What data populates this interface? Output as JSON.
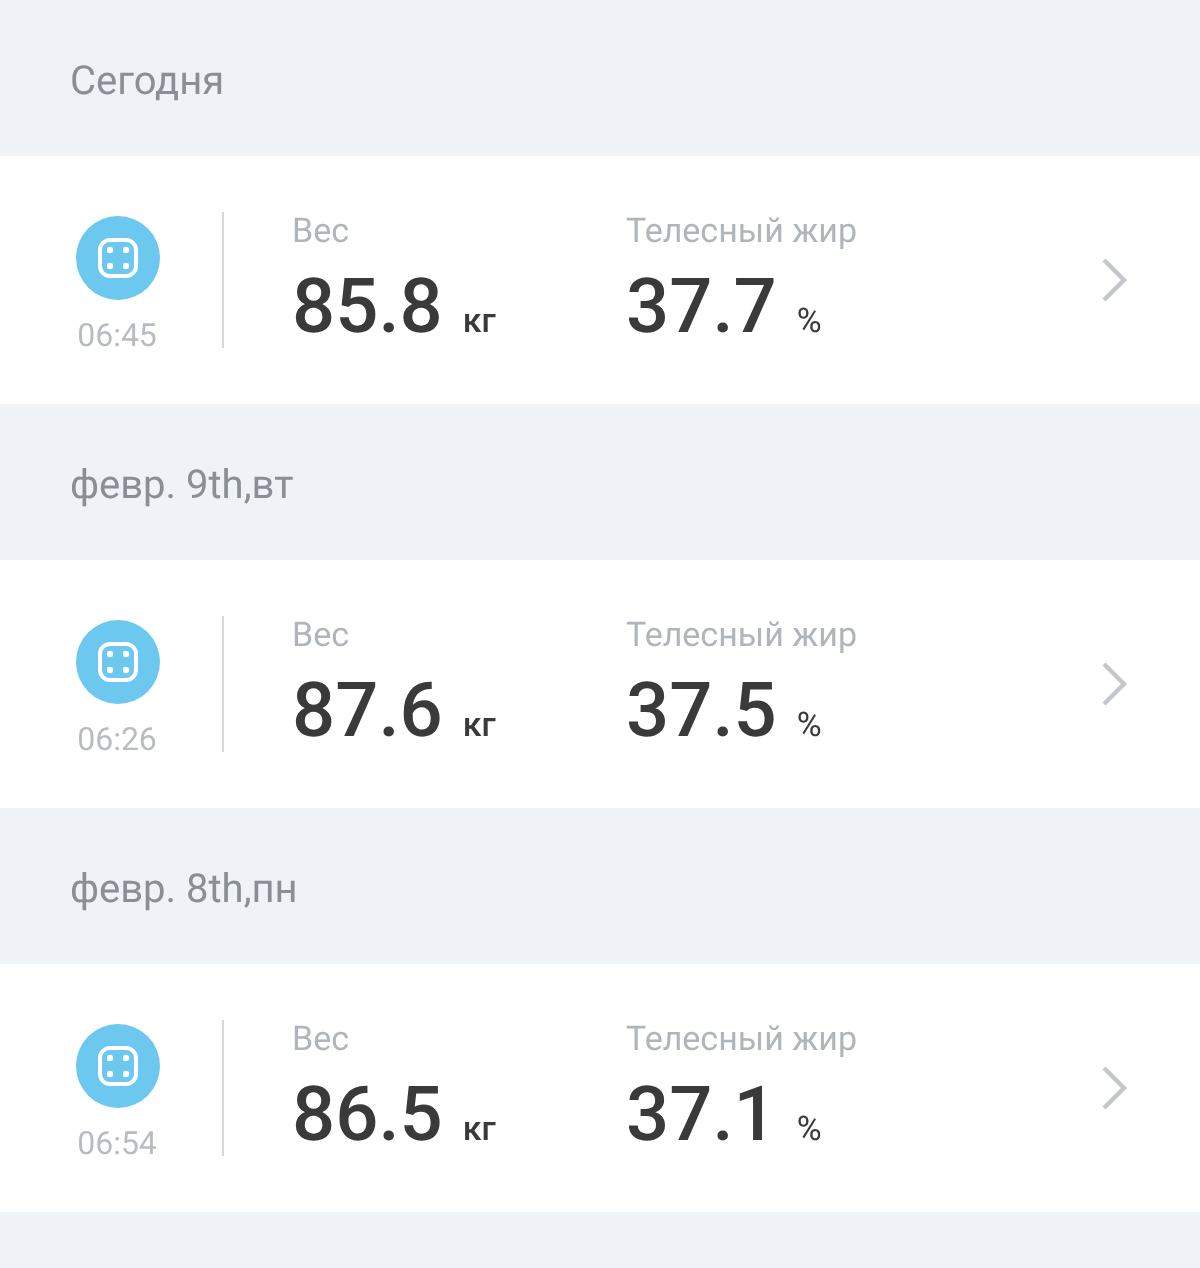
{
  "days": [
    {
      "date": "Сегодня",
      "entries": [
        {
          "time": "06:45",
          "weight_label": "Вес",
          "weight": "85.8",
          "weight_unit": "кг",
          "fat_label": "Телесный жир",
          "fat": "37.7",
          "fat_unit": "%"
        }
      ]
    },
    {
      "date": "февр. 9th,вт",
      "entries": [
        {
          "time": "06:26",
          "weight_label": "Вес",
          "weight": "87.6",
          "weight_unit": "кг",
          "fat_label": "Телесный жир",
          "fat": "37.5",
          "fat_unit": "%"
        }
      ]
    },
    {
      "date": "февр. 8th,пн",
      "entries": [
        {
          "time": "06:54",
          "weight_label": "Вес",
          "weight": "86.5",
          "weight_unit": "кг",
          "fat_label": "Телесный жир",
          "fat": "37.1",
          "fat_unit": "%"
        }
      ]
    }
  ]
}
